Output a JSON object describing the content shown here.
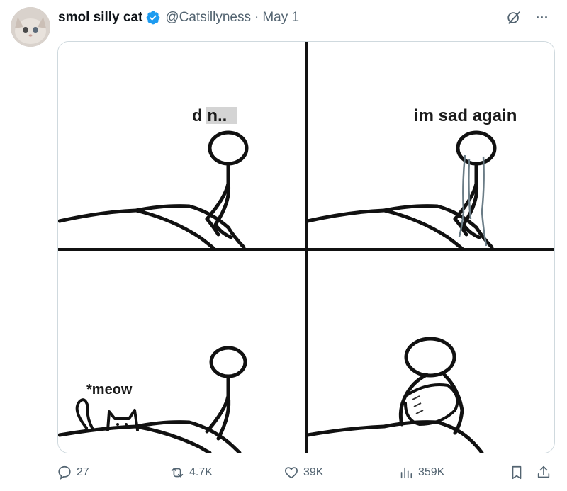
{
  "post": {
    "author_name": "smol silly cat",
    "handle": "@Catsillyness",
    "separator": "·",
    "date": "May 1",
    "more_label": "···"
  },
  "comic": {
    "panel1_text": "d   n..",
    "panel2_text": "im sad again",
    "panel3_text": "*meow"
  },
  "actions": {
    "replies": "27",
    "reposts": "4.7K",
    "likes": "39K",
    "views": "359K"
  },
  "colors": {
    "verified": "#1d9bf0",
    "secondary_text": "#536471",
    "border": "#cfd9de"
  }
}
